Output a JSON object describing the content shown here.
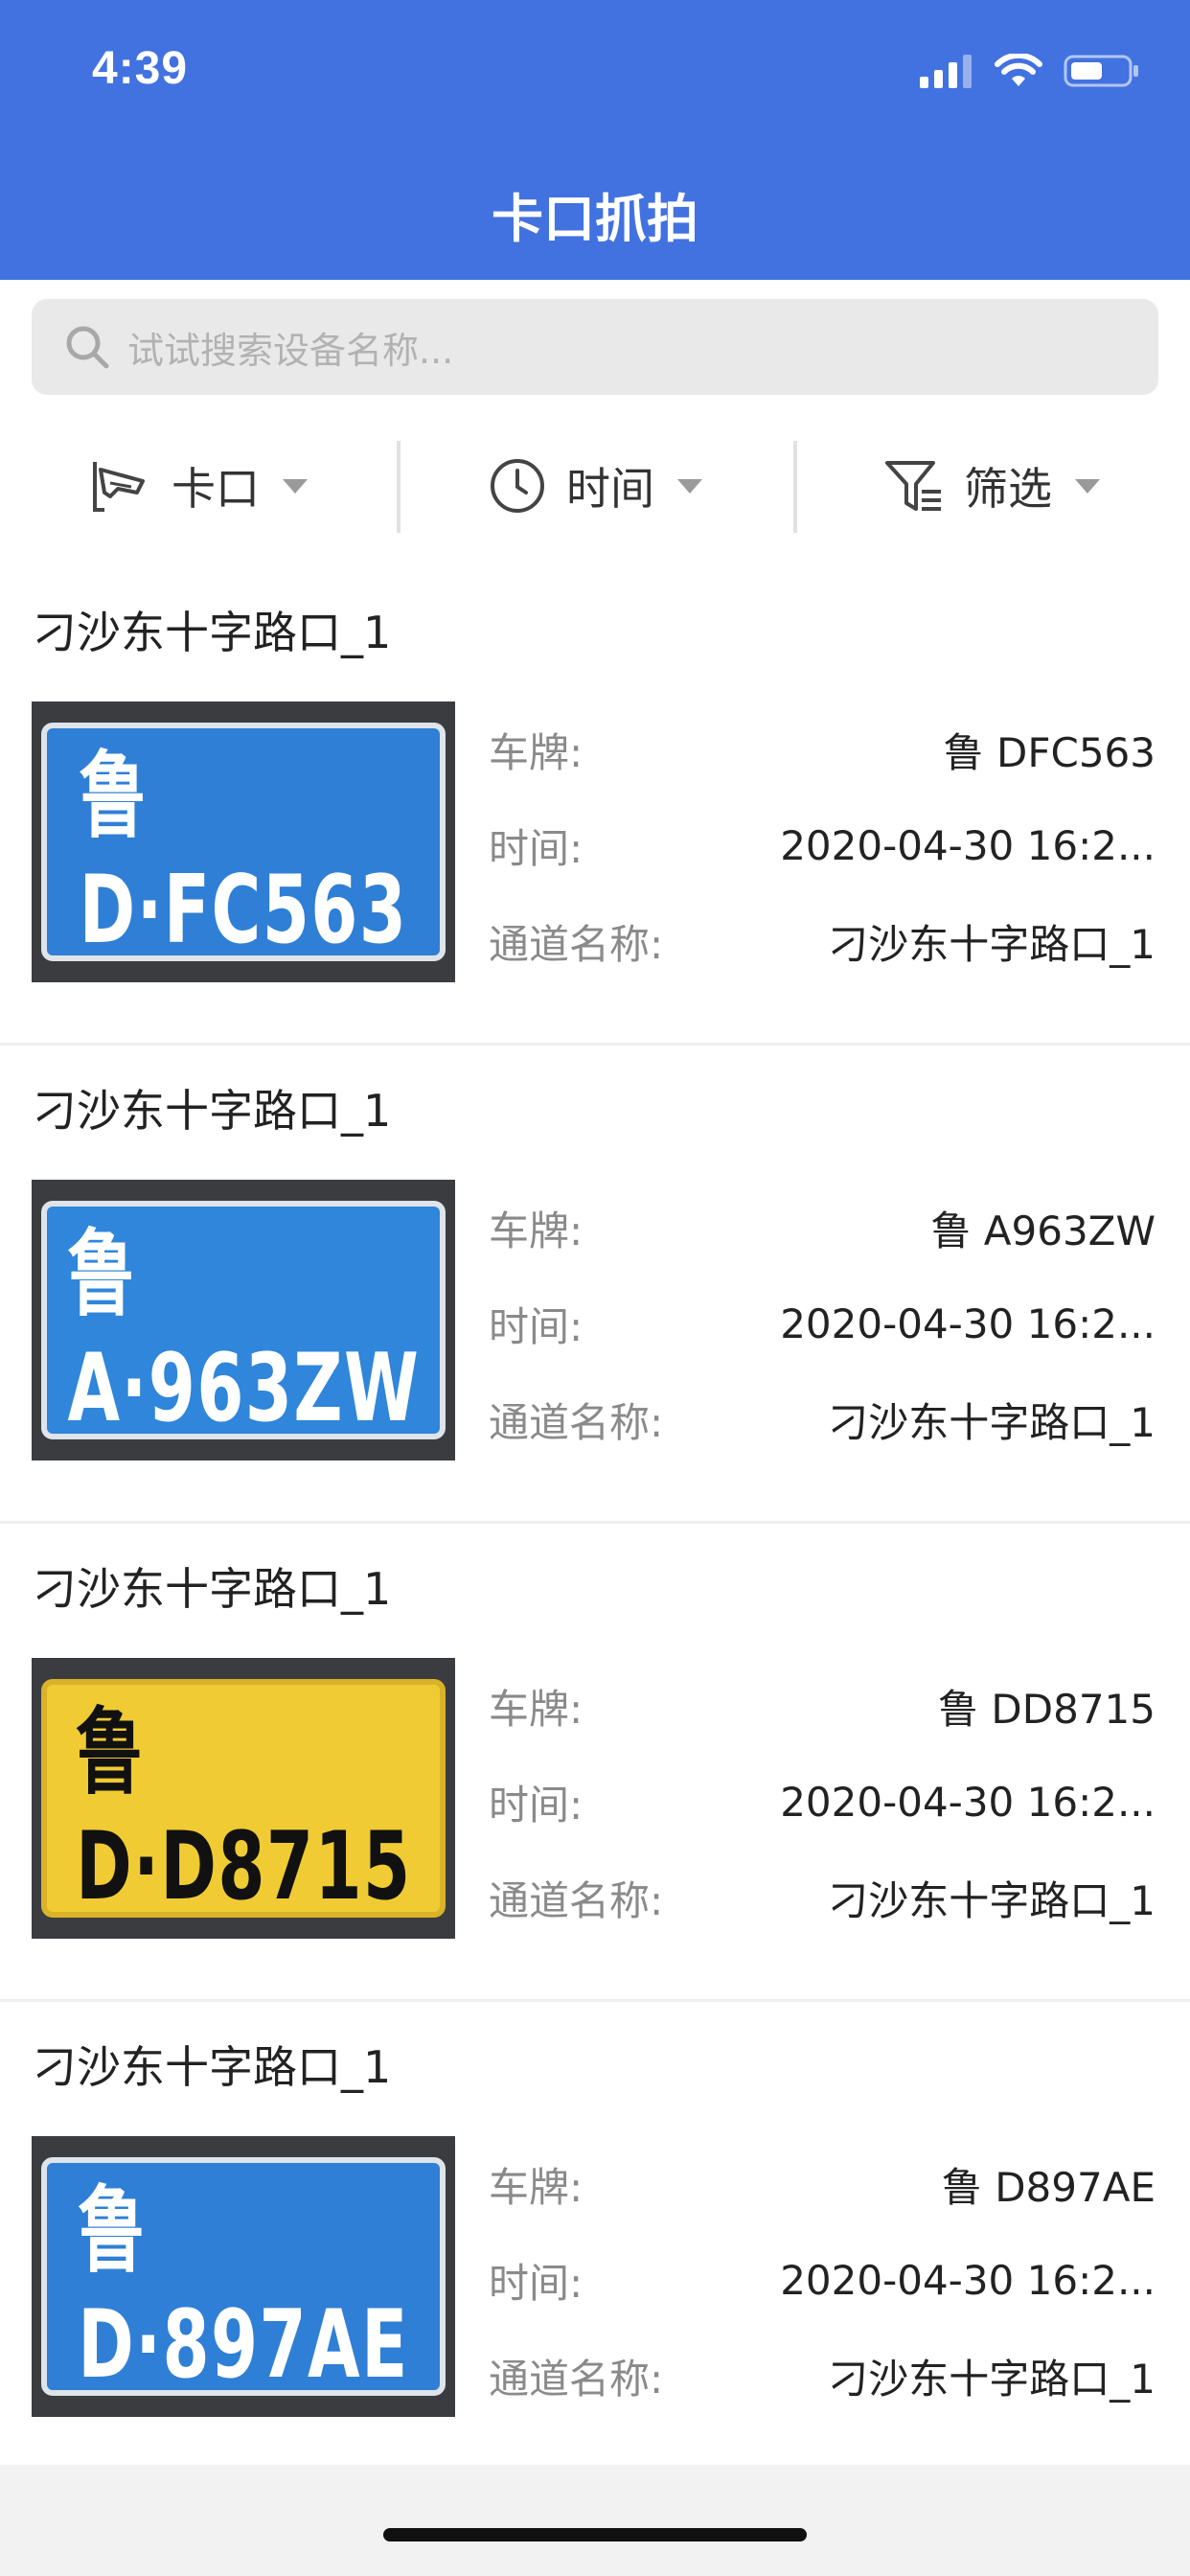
{
  "status": {
    "time": "4:39"
  },
  "header": {
    "title": "卡口抓拍"
  },
  "search": {
    "placeholder": "试试搜索设备名称..."
  },
  "filters": [
    {
      "label": "卡口",
      "icon": "camera-icon"
    },
    {
      "label": "时间",
      "icon": "clock-icon"
    },
    {
      "label": "筛选",
      "icon": "filter-icon"
    }
  ],
  "labels": {
    "plate": "车牌:",
    "time": "时间:",
    "channel": "通道名称:"
  },
  "items": [
    {
      "title": "刁沙东十字路口_1",
      "plate": "鲁 DFC563",
      "time": "2020-04-30 16:2...",
      "channel": "刁沙东十字路口_1",
      "plate_image_text": "鲁D·FC563",
      "plate_color": "#2f7fd6",
      "plate_text_color": "#ffffff"
    },
    {
      "title": "刁沙东十字路口_1",
      "plate": "鲁 A963ZW",
      "time": "2020-04-30 16:2...",
      "channel": "刁沙东十字路口_1",
      "plate_image_text": "鲁A·963ZW",
      "plate_color": "#2f86da",
      "plate_text_color": "#ffffff"
    },
    {
      "title": "刁沙东十字路口_1",
      "plate": "鲁 DD8715",
      "time": "2020-04-30 16:2...",
      "channel": "刁沙东十字路口_1",
      "plate_image_text": "鲁D·D8715",
      "plate_color": "#f0cb33",
      "plate_text_color": "#111111"
    },
    {
      "title": "刁沙东十字路口_1",
      "plate": "鲁 D897AE",
      "time": "2020-04-30 16:2...",
      "channel": "刁沙东十字路口_1",
      "plate_image_text": "鲁D·897AE",
      "plate_color": "#2f7fd6",
      "plate_text_color": "#ffffff"
    }
  ],
  "colors": {
    "header": "#4272e0",
    "background": "#f2f2f2"
  }
}
